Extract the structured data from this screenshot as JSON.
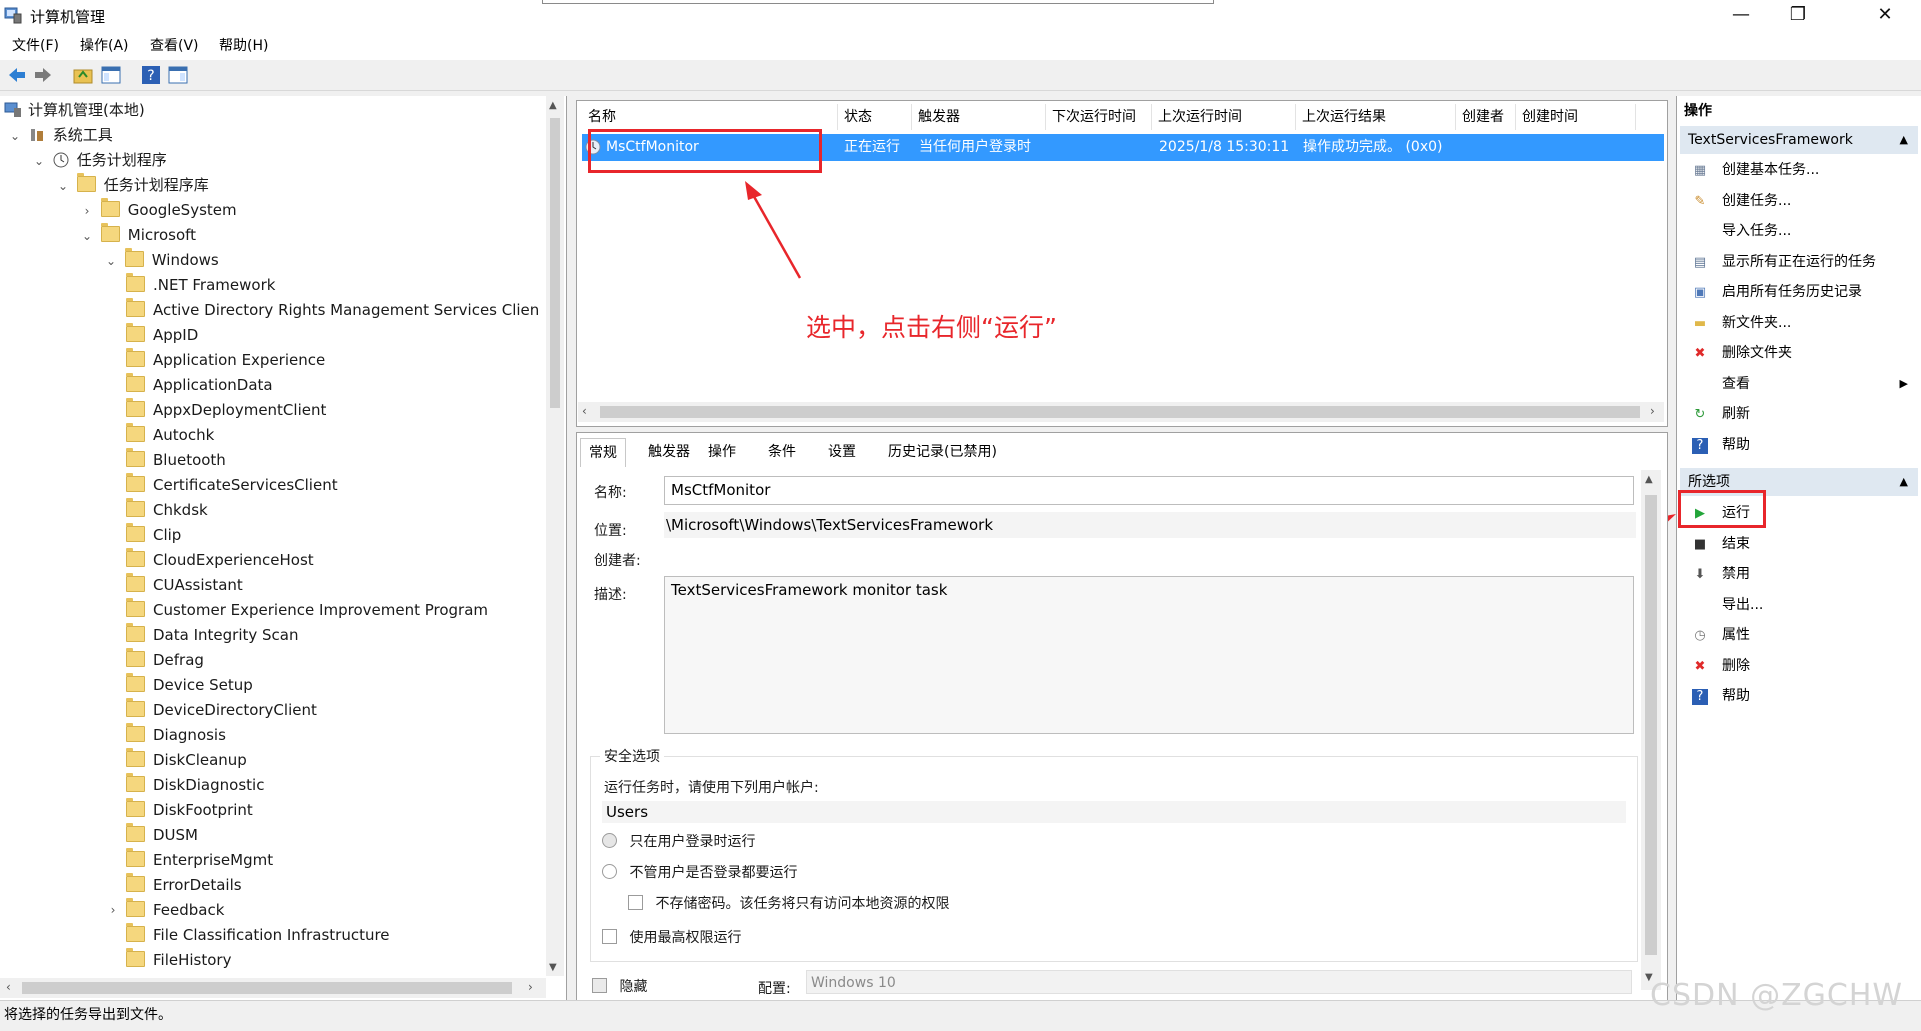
{
  "window": {
    "title": "计算机管理",
    "minimize": "—",
    "maximize": "❐",
    "close": "✕"
  },
  "menu": [
    "文件(F)",
    "操作(A)",
    "查看(V)",
    "帮助(H)"
  ],
  "tree": {
    "root": "计算机管理(本地)",
    "system_tools": "系统工具",
    "task_scheduler": "任务计划程序",
    "library": "任务计划程序库",
    "google_system": "GoogleSystem",
    "microsoft": "Microsoft",
    "windows": "Windows",
    "folders": [
      ".NET Framework",
      "Active Directory Rights Management Services Clien",
      "AppID",
      "Application Experience",
      "ApplicationData",
      "AppxDeploymentClient",
      "Autochk",
      "Bluetooth",
      "CertificateServicesClient",
      "Chkdsk",
      "Clip",
      "CloudExperienceHost",
      "CUAssistant",
      "Customer Experience Improvement Program",
      "Data Integrity Scan",
      "Defrag",
      "Device Setup",
      "DeviceDirectoryClient",
      "Diagnosis",
      "DiskCleanup",
      "DiskDiagnostic",
      "DiskFootprint",
      "DUSM",
      "EnterpriseMgmt",
      "ErrorDetails",
      "Feedback",
      "File Classification Infrastructure",
      "FileHistory"
    ]
  },
  "task_list": {
    "columns": [
      "名称",
      "状态",
      "触发器",
      "下次运行时间",
      "上次运行时间",
      "上次运行结果",
      "创建者",
      "创建时间"
    ],
    "row": {
      "name": "MsCtfMonitor",
      "status": "正在运行",
      "trigger": "当任何用户登录时",
      "last_run": "2025/1/8 15:30:11",
      "last_result": "操作成功完成。 (0x0)"
    }
  },
  "annotation": "选中，点击右侧“运行”",
  "detail": {
    "tabs": [
      "常规",
      "触发器",
      "操作",
      "条件",
      "设置",
      "历史记录(已禁用)"
    ],
    "name_label": "名称:",
    "name_value": "MsCtfMonitor",
    "location_label": "位置:",
    "location_value": "\\Microsoft\\Windows\\TextServicesFramework",
    "author_label": "创建者:",
    "desc_label": "描述:",
    "desc_value": "TextServicesFramework monitor task",
    "security_title": "安全选项",
    "run_as_text": "运行任务时，请使用下列用户帐户:",
    "user": "Users",
    "opt_logged_on": "只在用户登录时运行",
    "opt_whether_logged": "不管用户是否登录都要运行",
    "opt_no_password": "不存储密码。该任务将只有访问本地资源的权限",
    "opt_highest": "使用最高权限运行",
    "hidden_label": "隐藏",
    "config_label": "配置:",
    "config_value": "Windows 10"
  },
  "actions": {
    "header": "操作",
    "section1": "TextServicesFramework",
    "items1": [
      {
        "label": "创建基本任务...",
        "icon": "basic-task-icon"
      },
      {
        "label": "创建任务...",
        "icon": "create-task-icon"
      },
      {
        "label": "导入任务...",
        "icon": ""
      },
      {
        "label": "显示所有正在运行的任务",
        "icon": "running-tasks-icon"
      },
      {
        "label": "启用所有任务历史记录",
        "icon": "history-icon"
      },
      {
        "label": "新文件夹...",
        "icon": "new-folder-icon"
      },
      {
        "label": "删除文件夹",
        "icon": "delete-icon"
      },
      {
        "label": "查看",
        "icon": ""
      },
      {
        "label": "刷新",
        "icon": "refresh-icon"
      },
      {
        "label": "帮助",
        "icon": "help-icon"
      }
    ],
    "section2": "所选项",
    "items2": [
      {
        "label": "运行",
        "icon": "run-icon"
      },
      {
        "label": "结束",
        "icon": "stop-icon"
      },
      {
        "label": "禁用",
        "icon": "disable-icon"
      },
      {
        "label": "导出...",
        "icon": ""
      },
      {
        "label": "属性",
        "icon": "properties-icon"
      },
      {
        "label": "删除",
        "icon": "delete-icon"
      },
      {
        "label": "帮助",
        "icon": "help-icon"
      }
    ]
  },
  "status_text": "将选择的任务导出到文件。",
  "watermark": "CSDN @ZGCHW",
  "colors": {
    "selection": "#3399ff",
    "annotation": "#e8262b",
    "section_bg": "#dfe8f1"
  }
}
